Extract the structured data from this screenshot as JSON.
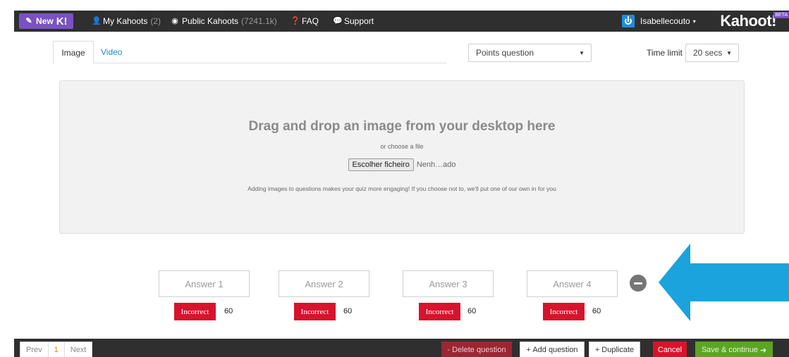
{
  "nav": {
    "new_label": "New",
    "new_k": "K!",
    "my_kahoots": "My Kahoots",
    "my_kahoots_count": "(2)",
    "public_kahoots": "Public Kahoots",
    "public_kahoots_count": "(7241.1k)",
    "faq": "FAQ",
    "support": "Support",
    "username": "Isabellecouto",
    "logo": "Kahoot!",
    "beta": "BETA"
  },
  "media_tabs": [
    {
      "label": "Image",
      "active": true
    },
    {
      "label": "Video",
      "active": false
    }
  ],
  "question_type": {
    "selected": "Points question"
  },
  "time_limit": {
    "label": "Time limit",
    "selected": "20 secs"
  },
  "dropzone": {
    "title": "Drag and drop an image from your desktop here",
    "or": "or choose a file",
    "file_button": "Escolher ficheiro",
    "file_status": "Nenh…ado",
    "hint": "Adding images to questions makes your quiz more engaging! If you choose not to, we'll put one of our own in for you"
  },
  "answers": [
    {
      "placeholder": "Answer 1",
      "status": "Incorrect",
      "seconds": "60"
    },
    {
      "placeholder": "Answer 2",
      "status": "Incorrect",
      "seconds": "60"
    },
    {
      "placeholder": "Answer 3",
      "status": "Incorrect",
      "seconds": "60"
    },
    {
      "placeholder": "Answer 4",
      "status": "Incorrect",
      "seconds": "60"
    }
  ],
  "pager": {
    "prev": "Prev",
    "current": "1",
    "next": "Next"
  },
  "actions": {
    "delete": "- Delete question",
    "add": "+ Add question",
    "duplicate": "+ Duplicate",
    "cancel": "Cancel",
    "save": "Save & continue"
  },
  "colors": {
    "accent_purple": "#7a52c2",
    "nav_bg": "#2f2f2f",
    "incorrect_red": "#d8132c",
    "save_green": "#5ca523",
    "arrow_blue": "#1aa3dc"
  }
}
